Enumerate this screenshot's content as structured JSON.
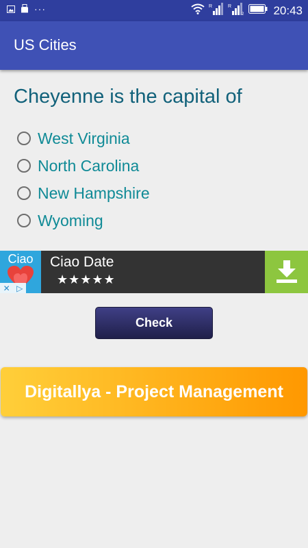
{
  "status_bar": {
    "time": "20:43",
    "overflow": "···",
    "icons": [
      "image-icon",
      "usb-icon",
      "wifi-icon",
      "signal-icon",
      "signal-icon",
      "battery-icon"
    ]
  },
  "app_bar": {
    "title": "US Cities"
  },
  "quiz": {
    "question": "Cheyenne is the capital of",
    "options": [
      {
        "label": "West Virginia",
        "selected": false
      },
      {
        "label": "North Carolina",
        "selected": false
      },
      {
        "label": "New Hampshire",
        "selected": false
      },
      {
        "label": "Wyoming",
        "selected": false
      }
    ],
    "check_label": "Check"
  },
  "ad": {
    "logo_text": "Ciao",
    "title": "Ciao Date",
    "rating_stars": "★★★★★",
    "rating_value": 5,
    "download_icon": "download-icon",
    "colors": {
      "logo_bg": "#2fa6dd",
      "download_bg": "#8dc63f",
      "banner_bg": "#333333"
    }
  },
  "promo": {
    "label": "Digitallya - Project Management"
  },
  "colors": {
    "status_bar": "#2f3e9e",
    "app_bar": "#3f51b5",
    "question": "#11617a",
    "option": "#0f8a96"
  }
}
